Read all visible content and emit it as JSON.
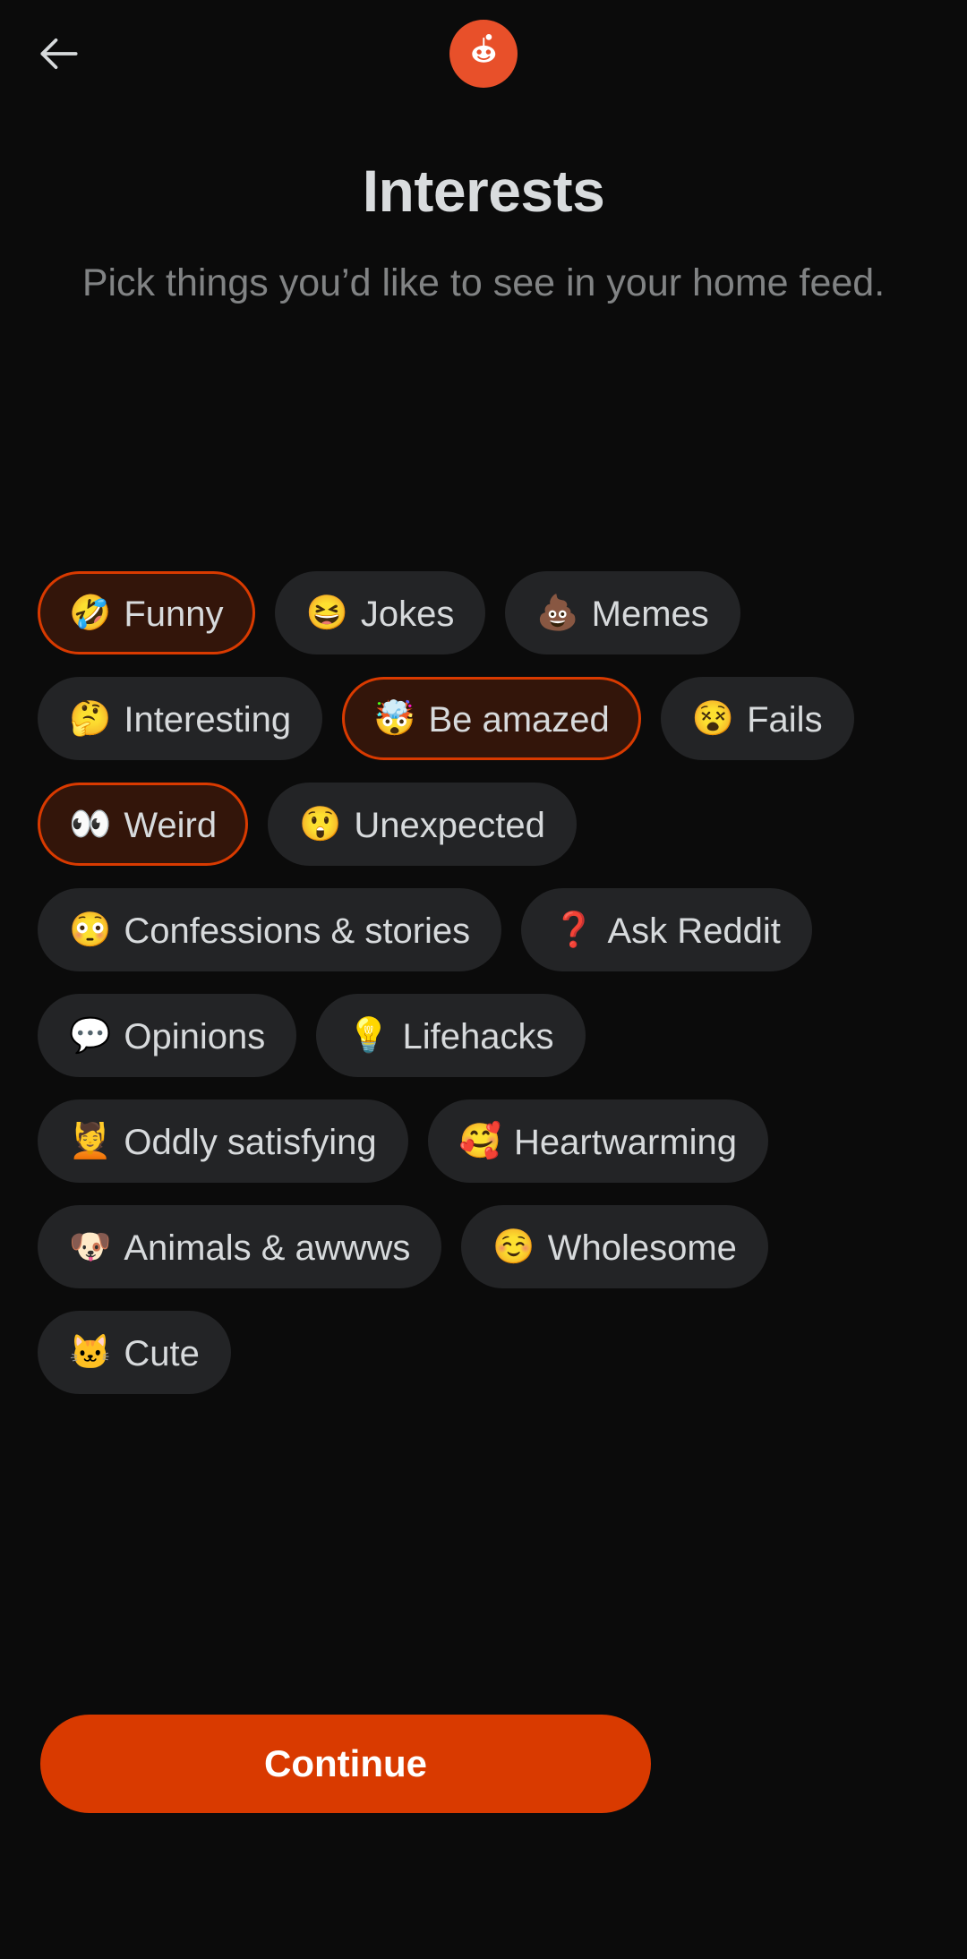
{
  "header": {
    "back_icon": "back-arrow-icon",
    "logo_icon": "reddit-snoo-logo"
  },
  "page": {
    "title": "Interests",
    "subtitle": "Pick things you’d like to see in your home feed."
  },
  "interests": [
    {
      "label": "Funny",
      "emoji": "🤣",
      "selected": true
    },
    {
      "label": "Jokes",
      "emoji": "😆",
      "selected": false
    },
    {
      "label": "Memes",
      "emoji": "💩",
      "selected": false
    },
    {
      "label": "Interesting",
      "emoji": "🤔",
      "selected": false
    },
    {
      "label": "Be amazed",
      "emoji": "🤯",
      "selected": true
    },
    {
      "label": "Fails",
      "emoji": "😵",
      "selected": false
    },
    {
      "label": "Weird",
      "emoji": "👀",
      "selected": true
    },
    {
      "label": "Unexpected",
      "emoji": "😲",
      "selected": false
    },
    {
      "label": "Confessions & stories",
      "emoji": "😳",
      "selected": false
    },
    {
      "label": "Ask Reddit",
      "emoji": "❓",
      "selected": false
    },
    {
      "label": "Opinions",
      "emoji": "💬",
      "selected": false
    },
    {
      "label": "Lifehacks",
      "emoji": "💡",
      "selected": false
    },
    {
      "label": "Oddly satisfying",
      "emoji": "💆",
      "selected": false
    },
    {
      "label": "Heartwarming",
      "emoji": "🥰",
      "selected": false
    },
    {
      "label": "Animals & awwws",
      "emoji": "🐶",
      "selected": false
    },
    {
      "label": "Wholesome",
      "emoji": "☺️",
      "selected": false
    },
    {
      "label": "Cute",
      "emoji": "🐱",
      "selected": false
    }
  ],
  "cta": {
    "continue_label": "Continue"
  },
  "colors": {
    "background": "#0B0B0B",
    "chip_background": "#232426",
    "chip_selected_background": "#33150A",
    "accent": "#D93A00",
    "logo_orange": "#E8502A",
    "text_primary": "#D7DADC",
    "text_secondary": "#818384"
  }
}
